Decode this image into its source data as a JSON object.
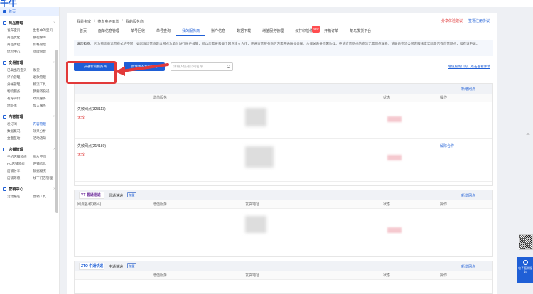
{
  "app": {
    "logo": "千牛"
  },
  "sidebar": {
    "home": "首页",
    "sections": [
      {
        "title": "商品管理",
        "items": [
          "发布宝贝",
          "出售中的宝贝",
          "商品优化",
          "质检保障",
          "商品体检",
          "价格管理",
          "体检中心",
          "品牌管理"
        ]
      },
      {
        "title": "交易管理",
        "items": [
          "已卖出的宝贝",
          "发货",
          "评价管理",
          "退款管理",
          "分帐管理",
          "物流工具",
          "物流服务",
          "我要寄快递",
          "有好评价",
          "政策服务",
          "地址库",
          "加入服务"
        ]
      },
      {
        "title": "内容管理",
        "items": [
          "发订阅",
          "内容管理",
          "数据概况",
          "效果分析",
          "全面互动",
          "活动通知"
        ]
      },
      {
        "title": "店铺管理",
        "items": [
          "手机店铺装修",
          "图片空间",
          "PC店铺装修",
          "店铺信息",
          "店铺分享",
          "数据概况",
          "店铺等级",
          "线下门店管理"
        ]
      },
      {
        "title": "营销中心",
        "items": [
          "活动报名",
          "营销工具"
        ]
      }
    ]
  },
  "breadcrumb": [
    "我是卖家",
    "菜鸟电子面单",
    "我的服务商"
  ],
  "top_links": [
    "分享体验建议",
    "签署注册协议"
  ],
  "tabs": [
    {
      "label": "首页",
      "active": false
    },
    {
      "label": "面单信息管理",
      "active": false
    },
    {
      "label": "单号回收",
      "active": false
    },
    {
      "label": "单号查询",
      "active": false
    },
    {
      "label": "我的服务商",
      "active": true
    },
    {
      "label": "账户信息",
      "active": false
    },
    {
      "label": "数据下载",
      "active": false
    },
    {
      "label": "增值服务管理",
      "active": false
    },
    {
      "label": "云打印插件",
      "active": false,
      "badge": "NEW"
    },
    {
      "label": "开箱订单",
      "active": false
    },
    {
      "label": "菜鸟发货平台",
      "active": false
    }
  ],
  "notice": {
    "key": "请您知晓：",
    "text": "因为物流商运营模式的不同，如您跟运营商是以网点为单位进行账户核算，所以您需要和每个网点建立合作，开通直营服务商后方需开通账号关联、合作关系并签署协议。申请直营网点的物流无需网点联系，请联系物流公司客服核实实际是否有直营网点，如有请申请。"
  },
  "toolbar": {
    "open_button": "开通新的服务商",
    "apply_button": "新增我的发货地址",
    "search_placeholder": "请输入快递公司名称",
    "link": "增值服务订购，点击查看详情"
  },
  "blocks": [
    {
      "logo": "",
      "name": "",
      "tag": "",
      "add": "新增网点",
      "columns": [
        "",
        "增值服务",
        "",
        "状态",
        "操作"
      ],
      "rows": [
        {
          "name": "失效网点(323113)",
          "status": "无效",
          "op": ""
        },
        {
          "name": "失效网点(214180)",
          "status": "无效",
          "op": "解除合作"
        }
      ]
    },
    {
      "logo": "YT 圆通速递",
      "name": "圆通速递",
      "tag": "加盟",
      "add": "新增网点",
      "columns": [
        "网点名称(编码)",
        "增值服务",
        "发货地址",
        "状态",
        "操作"
      ],
      "rows": [
        {
          "name": "",
          "status": "",
          "op": ""
        }
      ]
    },
    {
      "logo": "ZTO 中通快递",
      "name": "中通快递",
      "tag": "加盟",
      "add": "新增网点",
      "columns": [
        "",
        "增值服务",
        "发货地址",
        "状态",
        "操作"
      ],
      "rows": []
    }
  ],
  "floaters": {
    "service_label": "电子面单服务"
  },
  "colors": {
    "accent": "#1f5fd6",
    "highlight": "#e23a3a",
    "danger": "#e03a3a"
  }
}
